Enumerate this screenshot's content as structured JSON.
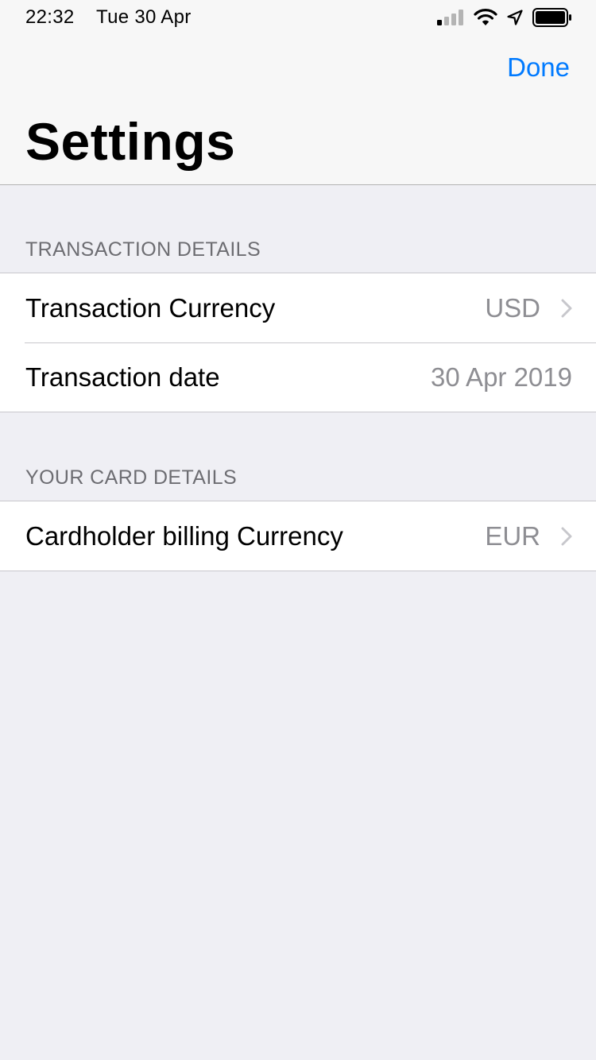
{
  "status_bar": {
    "time": "22:32",
    "date": "Tue 30 Apr",
    "icons": [
      "cellular-signal-icon",
      "wifi-icon",
      "location-arrow-icon",
      "battery-icon"
    ]
  },
  "nav": {
    "done_label": "Done",
    "title": "Settings"
  },
  "sections": [
    {
      "header": "TRANSACTION DETAILS",
      "rows": [
        {
          "label": "Transaction Currency",
          "value": "USD",
          "disclosure": true
        },
        {
          "label": "Transaction date",
          "value": "30 Apr 2019",
          "disclosure": false
        }
      ]
    },
    {
      "header": "YOUR CARD DETAILS",
      "rows": [
        {
          "label": "Cardholder billing Currency",
          "value": "EUR",
          "disclosure": true
        }
      ]
    }
  ],
  "colors": {
    "accent": "#007aff",
    "background": "#efeff4",
    "secondary_text": "#8e8e93",
    "separator": "#c8c7cc"
  }
}
